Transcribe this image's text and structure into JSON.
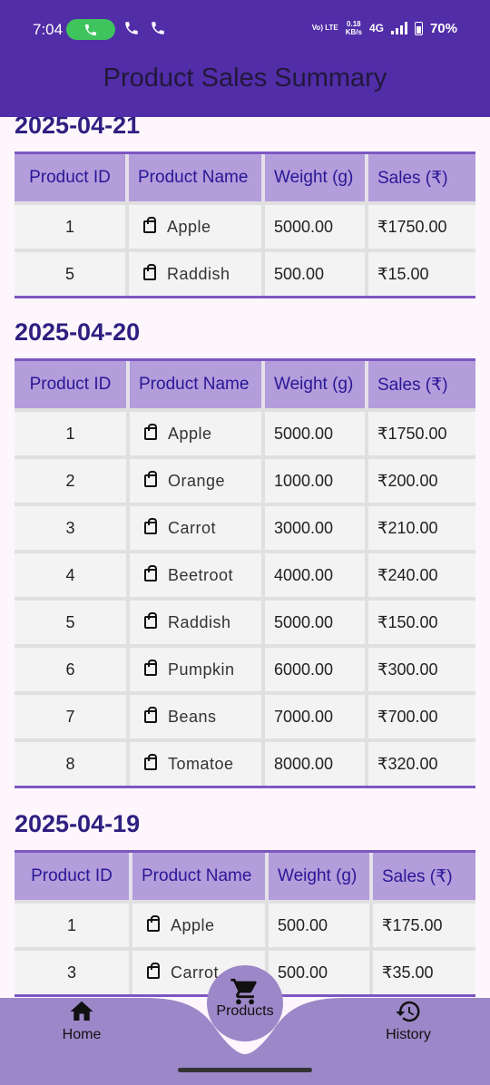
{
  "status": {
    "time": "7:04",
    "volte": "Vo) LTE",
    "speed_top": "0.18",
    "speed_bottom": "KB/s",
    "network": "4G",
    "battery": "70%"
  },
  "app_bar": {
    "title": "Product Sales Summary"
  },
  "table_headers": [
    "Product ID",
    "Product Name",
    "Weight (g)",
    "Sales (₹)"
  ],
  "sections": [
    {
      "date": "2025-04-21",
      "rows": [
        {
          "id": "1",
          "name": "Apple",
          "weight": "5000.00",
          "sales": "₹1750.00"
        },
        {
          "id": "5",
          "name": "Raddish",
          "weight": "500.00",
          "sales": "₹15.00"
        }
      ]
    },
    {
      "date": "2025-04-20",
      "rows": [
        {
          "id": "1",
          "name": "Apple",
          "weight": "5000.00",
          "sales": "₹1750.00"
        },
        {
          "id": "2",
          "name": "Orange",
          "weight": "1000.00",
          "sales": "₹200.00"
        },
        {
          "id": "3",
          "name": "Carrot",
          "weight": "3000.00",
          "sales": "₹210.00"
        },
        {
          "id": "4",
          "name": "Beetroot",
          "weight": "4000.00",
          "sales": "₹240.00"
        },
        {
          "id": "5",
          "name": "Raddish",
          "weight": "5000.00",
          "sales": "₹150.00"
        },
        {
          "id": "6",
          "name": "Pumpkin",
          "weight": "6000.00",
          "sales": "₹300.00"
        },
        {
          "id": "7",
          "name": "Beans",
          "weight": "7000.00",
          "sales": "₹700.00"
        },
        {
          "id": "8",
          "name": "Tomatoe",
          "weight": "8000.00",
          "sales": "₹320.00"
        }
      ]
    },
    {
      "date": "2025-04-19",
      "rows": [
        {
          "id": "1",
          "name": "Apple",
          "weight": "500.00",
          "sales": "₹175.00"
        },
        {
          "id": "3",
          "name": "Carrot",
          "weight": "500.00",
          "sales": "₹35.00"
        }
      ]
    }
  ],
  "bottom_nav": {
    "home": "Home",
    "products": "Products",
    "history": "History"
  },
  "colors": {
    "app_bar": "#512da8",
    "header_row": "#b39ddb",
    "date_text": "#2e1f80",
    "bottom_nav": "#9c87c8"
  },
  "icons": [
    "phone-icon",
    "shopping-bag-icon",
    "home-icon",
    "cart-icon",
    "history-icon"
  ]
}
